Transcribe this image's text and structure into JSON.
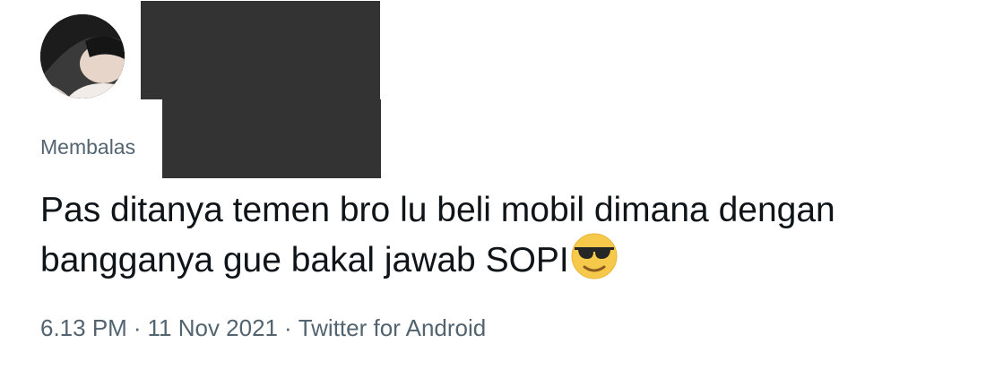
{
  "reply": {
    "prefix": "Membalas"
  },
  "tweet": {
    "line1": "Pas ditanya temen bro lu beli mobil dimana dengan",
    "line2": "bangganya gue bakal jawab SOPI",
    "emoji": "smiling-face-with-sunglasses"
  },
  "meta": {
    "time": "6.13 PM",
    "separator": "·",
    "date": "11 Nov 2021",
    "source": "Twitter for Android"
  }
}
